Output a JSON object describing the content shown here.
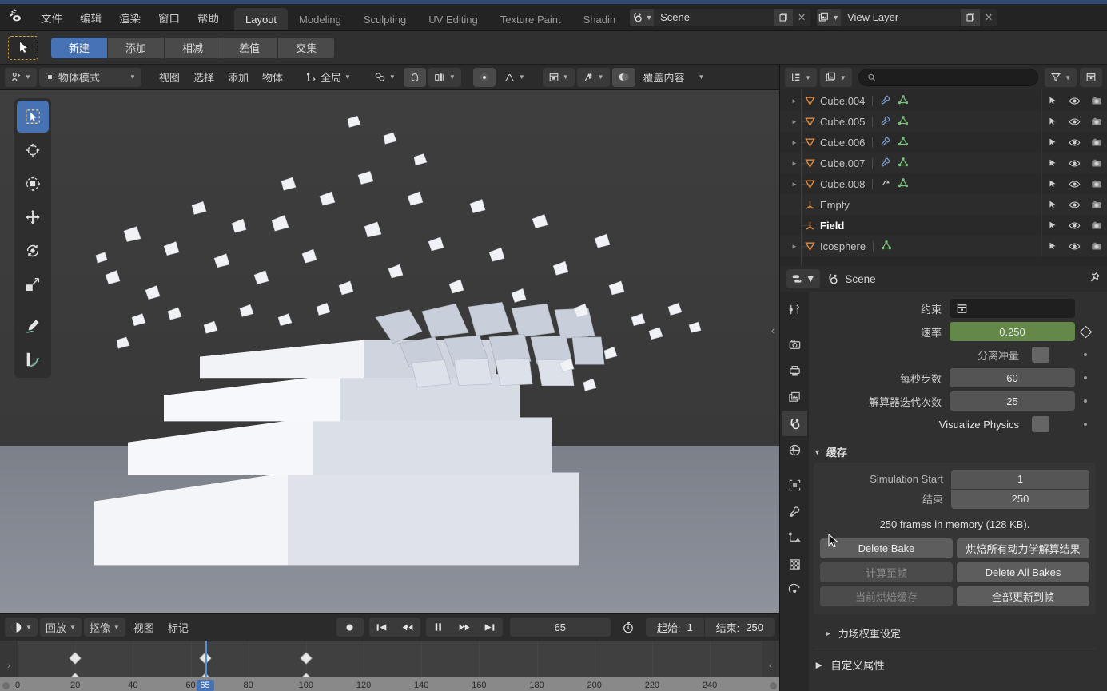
{
  "app": {
    "title": "Blender",
    "logo_icon": "blender-logo-icon"
  },
  "topbar": {
    "menus": [
      "文件",
      "编辑",
      "渲染",
      "窗口",
      "帮助"
    ],
    "workspace_tabs": [
      {
        "label": "Layout",
        "active": true
      },
      {
        "label": "Modeling",
        "active": false
      },
      {
        "label": "Sculpting",
        "active": false
      },
      {
        "label": "UV Editing",
        "active": false
      },
      {
        "label": "Texture Paint",
        "active": false
      },
      {
        "label": "Shadin",
        "active": false
      }
    ],
    "scene": {
      "icon": "scene-icon",
      "name": "Scene",
      "new_icon": "new-scene-icon",
      "close_icon": "close-icon"
    },
    "view_layer": {
      "icon": "view-layer-icon",
      "name": "View Layer",
      "new_icon": "new-layer-icon",
      "close_icon": "close-icon"
    }
  },
  "toolsettings": {
    "active_tool_icon": "select-box-tool-icon",
    "select_modes": [
      {
        "label": "新建",
        "active": true
      },
      {
        "label": "添加",
        "active": false
      },
      {
        "label": "相减",
        "active": false
      },
      {
        "label": "差值",
        "active": false
      },
      {
        "label": "交集",
        "active": false
      }
    ]
  },
  "viewport_header": {
    "editor_type_icon": "editor-type-3dview-icon",
    "mode": "物体模式",
    "menus": [
      "视图",
      "选择",
      "添加",
      "物体"
    ],
    "transform_orientation": {
      "icon": "orientation-icon",
      "label": "全局"
    },
    "snap_icon": "magnet-icon",
    "snap_target_icon": "snap-increment-icon",
    "proportional_icon": "proportional-edit-icon",
    "falloff_icon": "falloff-smooth-icon",
    "shading_icon": "shading-solid-icon",
    "gizmo_icon": "gizmo-icon",
    "overlay_icon": "overlays-icon",
    "overlay_label": "覆盖内容"
  },
  "viewport_tools": [
    {
      "name": "tweak-select-box-tool",
      "icon": "select-box-icon",
      "active": true
    },
    {
      "name": "cursor-tool",
      "icon": "3d-cursor-icon",
      "active": false
    },
    {
      "name": "transform-tool",
      "icon": "transform-icon",
      "active": false
    },
    {
      "name": "move-tool",
      "icon": "move-icon",
      "active": false
    },
    {
      "name": "rotate-tool",
      "icon": "rotate-icon",
      "active": false
    },
    {
      "name": "scale-tool",
      "icon": "scale-icon",
      "active": false
    },
    {
      "name": "annotate-tool",
      "icon": "annotate-pencil-icon",
      "active": false
    },
    {
      "name": "measure-tool",
      "icon": "measure-ruler-icon",
      "active": false
    }
  ],
  "outliner": {
    "display_mode_icon": "outliner-display-mode-icon",
    "filter_id_icon": "blender-file-icon",
    "search_placeholder": "",
    "search_value": "",
    "filter_icon": "filter-funnel-icon",
    "new_collection_icon": "new-collection-icon",
    "column_icons": [
      "selectable-arrow-icon",
      "eye-icon",
      "camera-icon"
    ],
    "rows": [
      {
        "name": "Cube.004",
        "icon": "mesh-object-icon",
        "expandable": true,
        "bold": false,
        "data_icons": [
          "modifier-wrench-icon",
          "mesh-data-icon"
        ]
      },
      {
        "name": "Cube.005",
        "icon": "mesh-object-icon",
        "expandable": true,
        "bold": false,
        "data_icons": [
          "modifier-wrench-icon",
          "mesh-data-icon"
        ]
      },
      {
        "name": "Cube.006",
        "icon": "mesh-object-icon",
        "expandable": true,
        "bold": false,
        "data_icons": [
          "modifier-wrench-icon",
          "mesh-data-icon"
        ]
      },
      {
        "name": "Cube.007",
        "icon": "mesh-object-icon",
        "expandable": true,
        "bold": false,
        "data_icons": [
          "modifier-wrench-icon",
          "mesh-data-icon"
        ]
      },
      {
        "name": "Cube.008",
        "icon": "mesh-object-icon",
        "expandable": true,
        "bold": false,
        "data_icons": [
          "physics-icon",
          "mesh-data-icon"
        ]
      },
      {
        "name": "Empty",
        "icon": "empty-axes-icon",
        "expandable": false,
        "bold": false,
        "data_icons": []
      },
      {
        "name": "Field",
        "icon": "force-field-icon",
        "expandable": false,
        "bold": true,
        "data_icons": []
      },
      {
        "name": "Icosphere",
        "icon": "mesh-object-icon",
        "expandable": true,
        "bold": false,
        "data_icons": [
          "mesh-data-icon"
        ]
      }
    ]
  },
  "properties": {
    "editor_icon": "properties-editor-icon",
    "breadcrumb_icon": "scene-properties-icon",
    "breadcrumb": "Scene",
    "pin_icon": "pin-icon",
    "tabs": [
      {
        "name": "tool",
        "icon": "tool-icon",
        "active": false
      },
      {
        "name": "render",
        "icon": "render-camera-icon",
        "active": false
      },
      {
        "name": "output",
        "icon": "output-printer-icon",
        "active": false
      },
      {
        "name": "view-layer",
        "icon": "view-layer-images-icon",
        "active": false
      },
      {
        "name": "scene",
        "icon": "scene-properties-icon",
        "active": true
      },
      {
        "name": "world",
        "icon": "world-globe-icon",
        "active": false
      },
      {
        "name": "object",
        "icon": "object-square-icon",
        "active": false
      },
      {
        "name": "modifiers",
        "icon": "wrench-icon",
        "active": false
      },
      {
        "name": "object-constraints",
        "icon": "constraint-icon",
        "active": false
      },
      {
        "name": "object-data",
        "icon": "checker-data-icon",
        "active": false
      },
      {
        "name": "physics",
        "icon": "physics-orbit-icon",
        "active": false
      }
    ],
    "rigidbody": {
      "constraint_label": "约束",
      "constraint_value": "",
      "constraint_icon": "collection-icon",
      "speed_label": "速率",
      "speed_value": "0.250",
      "speed_keyframe_icon": "keyframe-diamond-icon",
      "split_impulse_label": "分离冲量",
      "split_impulse_checked": false,
      "steps_label": "每秒步数",
      "steps_value": "60",
      "solver_label": "解算器迭代次数",
      "solver_value": "25",
      "visualize_label": "Visualize Physics",
      "visualize_checked": false
    },
    "cache": {
      "title": "缓存",
      "expanded": true,
      "start_label": "Simulation Start",
      "start_value": "1",
      "end_label": "结束",
      "end_value": "250",
      "note": "250 frames in memory (128 KB).",
      "buttons": [
        {
          "label": "Delete Bake",
          "disabled": false
        },
        {
          "label": "烘焙所有动力学解算结果",
          "disabled": false
        },
        {
          "label": "计算至帧",
          "disabled": true
        },
        {
          "label": "Delete All Bakes",
          "disabled": false
        },
        {
          "label": "当前烘焙缓存",
          "disabled": true
        },
        {
          "label": "全部更新到帧",
          "disabled": false
        }
      ]
    },
    "field_weights_section": "力场权重设定",
    "custom_props_section": "自定义属性"
  },
  "timeline": {
    "editor_icon": "timeline-editor-icon",
    "menus": [
      {
        "label": "回放",
        "dropdown": true
      },
      {
        "label": "抠像",
        "dropdown": true
      },
      {
        "label": "视图",
        "dropdown": false
      },
      {
        "label": "标记",
        "dropdown": false
      }
    ],
    "playback": [
      {
        "name": "record-keyframes-button",
        "icon": "record-dot-icon"
      },
      {
        "name": "jump-to-start-button",
        "icon": "jump-start-icon"
      },
      {
        "name": "jump-to-prev-keyframe-button",
        "icon": "prev-keyframe-icon"
      },
      {
        "name": "play-pause-button",
        "icon": "pause-icon"
      },
      {
        "name": "jump-to-next-keyframe-button",
        "icon": "next-keyframe-icon"
      },
      {
        "name": "jump-to-end-button",
        "icon": "jump-end-icon"
      }
    ],
    "current_frame": "65",
    "clock_icon": "auto-key-clock-icon",
    "start_label": "起始:",
    "start_value": "1",
    "end_label": "结束:",
    "end_value": "250",
    "ruler_ticks": [
      "0",
      "20",
      "40",
      "60",
      "80",
      "100",
      "120",
      "140",
      "160",
      "180",
      "200",
      "220",
      "240"
    ],
    "playhead_frame": 65,
    "keyframes_row1": [
      20,
      65,
      100
    ],
    "keyframes_row2": [
      20,
      65,
      100
    ]
  },
  "colors": {
    "accent_blue": "#4772b3",
    "header_bg": "#2b2b2b",
    "panel_bg": "#303030",
    "value_green": "#63884a",
    "outliner_orange": "#e08c3a",
    "mesh_data_green": "#7ac07a",
    "modifier_blue": "#7a9fd4"
  }
}
